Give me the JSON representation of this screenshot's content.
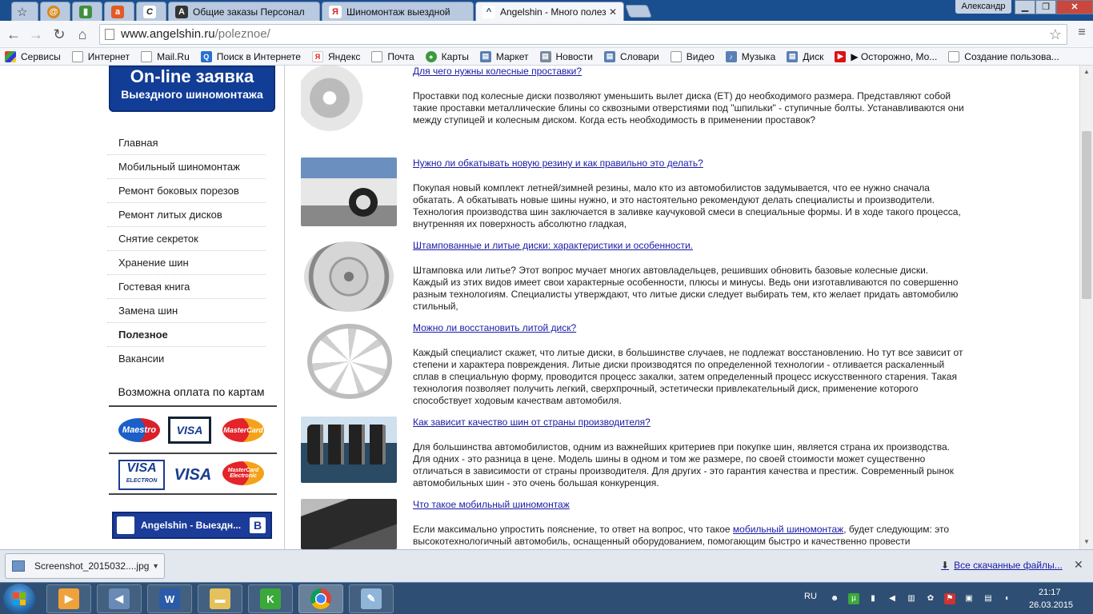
{
  "window": {
    "tabs": [
      {
        "label": "",
        "icon": "opera-icon"
      },
      {
        "label": "",
        "icon": "chart-icon"
      },
      {
        "label": "",
        "icon": "avito-icon"
      },
      {
        "label": "",
        "icon": "c-icon"
      },
      {
        "label": "Общие заказы Персонал",
        "icon": "a-icon"
      },
      {
        "label": "Шиномонтаж выездной",
        "icon": "yandex-icon"
      },
      {
        "label": "Angelshin - Много полез",
        "icon": "angelshin-icon"
      }
    ],
    "user": "Александр",
    "controls": {
      "minimize": "▁",
      "maximize": "❐",
      "close": "✕"
    }
  },
  "toolbar": {
    "url_domain": "www.angelshin.ru",
    "url_path": "/poleznoe/"
  },
  "bookmarks": [
    {
      "label": "Сервисы",
      "icon": "apps-icon"
    },
    {
      "label": "Интернет",
      "icon": "page-icon"
    },
    {
      "label": "Mail.Ru",
      "icon": "page-icon"
    },
    {
      "label": "Поиск в Интернете",
      "icon": "search-icon"
    },
    {
      "label": "Яндекс",
      "icon": "yandex-icon"
    },
    {
      "label": "Почта",
      "icon": "page-icon"
    },
    {
      "label": "Карты",
      "icon": "maps-icon"
    },
    {
      "label": "Маркет",
      "icon": "market-icon"
    },
    {
      "label": "Новости",
      "icon": "news-icon"
    },
    {
      "label": "Словари",
      "icon": "dictionary-icon"
    },
    {
      "label": "Видео",
      "icon": "page-icon"
    },
    {
      "label": "Музыка",
      "icon": "music-icon"
    },
    {
      "label": "Диск",
      "icon": "disk-icon"
    },
    {
      "label": "▶ Осторожно, Мо...",
      "icon": "youtube-icon"
    },
    {
      "label": "Создание пользова...",
      "icon": "page-icon"
    }
  ],
  "sidebar": {
    "order_title": "On-line заявка",
    "order_subtitle": "Выездного шиномонтажа",
    "menu": [
      {
        "label": "Главная",
        "active": false
      },
      {
        "label": "Мобильный шиномонтаж",
        "active": false
      },
      {
        "label": "Ремонт боковых порезов",
        "active": false
      },
      {
        "label": "Ремонт литых дисков",
        "active": false
      },
      {
        "label": "Снятие секреток",
        "active": false
      },
      {
        "label": "Хранение шин",
        "active": false
      },
      {
        "label": "Гостевая книга",
        "active": false
      },
      {
        "label": "Замена шин",
        "active": false
      },
      {
        "label": "Полезное",
        "active": true
      },
      {
        "label": "Вакансии",
        "active": false
      }
    ],
    "payment_title": "Возможна оплата по картам",
    "cards": [
      "Maestro",
      "VISA",
      "MasterCard",
      "VISA",
      "VISA",
      "MasterCard Electronic"
    ],
    "card_small": "ELECTRON",
    "social_button": "Angelshin - Выездн...",
    "social_button_badge": "B"
  },
  "articles": [
    {
      "title": "Для чего нужны колесные проставки?",
      "text": "Проставки под колесные диски позволяют уменьшить вылет диска (ЕТ) до необходимого размера. Представляют собой такие проставки металлические блины со сквозными отверстиями под \"шпильки\" - ступичные болты. Устанавливаются они между ступицей и колесным диском. Когда есть необходимость в применении проставок?"
    },
    {
      "title": "Нужно ли обкатывать новую резину и как правильно это делать?",
      "text": "Покупая новый комплект летней/зимней резины, мало кто из автомобилистов задумывается, что ее нужно сначала обкатать. А обкатывать новые шины нужно, и это настоятельно рекомендуют делать специалисты и производители. Технология производства шин заключается в заливке каучуковой смеси в специальные формы. И в ходе такого процесса, внутренняя их поверхность абсолютно гладкая,"
    },
    {
      "title": "Штампованные и литые диски: характеристики и особенности.",
      "text": "Штамповка или литье? Этот вопрос мучает многих автовладельцев, решивших обновить базовые колесные диски. Каждый из этих видов имеет свои характерные особенности, плюсы и минусы. Ведь они изготавливаются по совершенно разным технологиям. Специалисты утверждают, что литые диски следует выбирать тем, кто желает придать автомобилю стильный,"
    },
    {
      "title": "Можно ли восстановить литой диск?",
      "text": "Каждый специалист скажет, что литые диски, в большинстве случаев, не подлежат восстановлению. Но тут все зависит от степени и характера повреждения. Литые диски производятся по определенной технологии - отливается раскаленный сплав в специальную форму, проводится процесс закалки, затем определенный процесс искусственного старения. Такая технология позволяет получить легкий, сверхпрочный, эстетически привлекательный диск, применение которого способствует ходовым качествам автомобиля."
    },
    {
      "title": "Как зависит качество шин от страны производителя?",
      "text": "Для большинства автомобилистов, одним из важнейших критериев при покупке шин, является страна их производства. Для одних - это разница в цене. Модель шины в одном и том же размере, по своей стоимости может существенно отличаться в зависимости от страны производителя. Для других - это гарантия качества и престиж. Современный рынок автомобильных шин - это очень большая конкуренция."
    },
    {
      "title": "Что такое мобильный шиномонтаж",
      "text_before": "Если максимально упростить пояснение, то ответ на вопрос, что такое ",
      "text_link": "мобильный шиномонтаж",
      "text_after": ", будет следующим: это высокотехнологичный автомобиль, оснащенный оборудованием, помогающим быстро и качественно провести"
    }
  ],
  "downloads": {
    "file": "Screenshot_2015032....jpg",
    "show_all": "Все скачанные файлы..."
  },
  "taskbar": {
    "lang": "RU",
    "time": "21:17",
    "date": "26.03.2015"
  }
}
